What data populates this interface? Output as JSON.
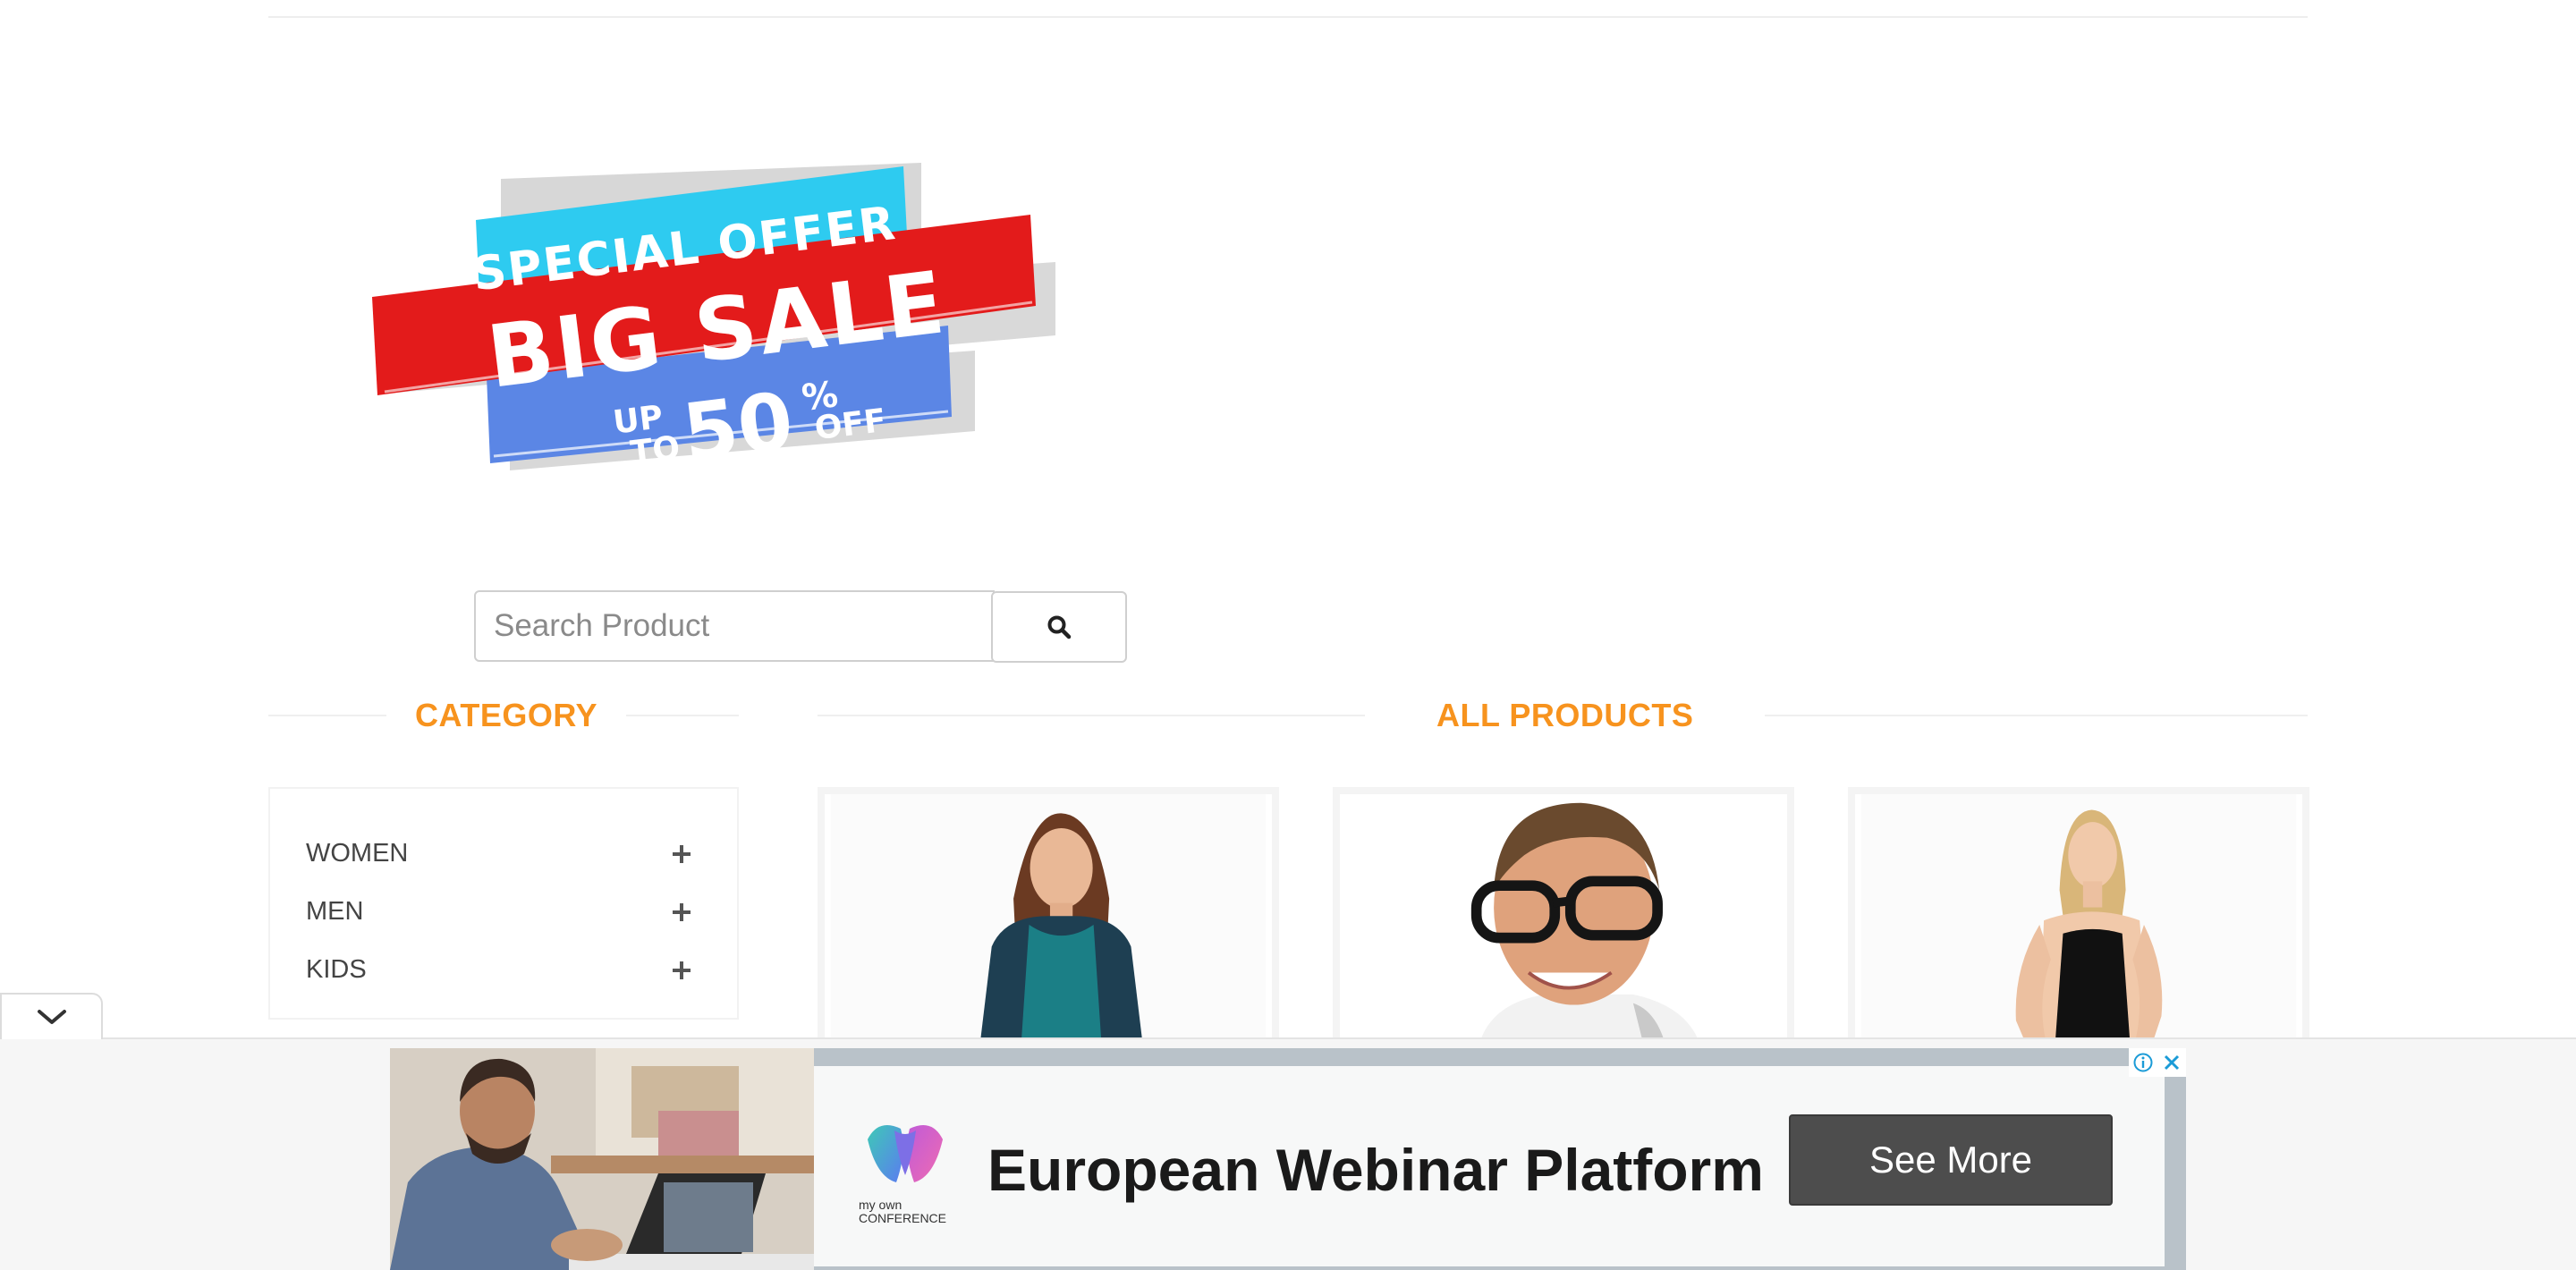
{
  "banner": {
    "line1": "SPECIAL OFFER",
    "line2": "BIG SALE",
    "up": "UP",
    "to": "TO",
    "amount": "50",
    "percent": "%",
    "off": "OFF"
  },
  "search": {
    "placeholder": "Search Product",
    "icon": "search-icon"
  },
  "category": {
    "title": "CATEGORY",
    "items": [
      {
        "label": "WOMEN",
        "icon": "plus-icon"
      },
      {
        "label": "MEN",
        "icon": "plus-icon"
      },
      {
        "label": "KIDS",
        "icon": "plus-icon"
      }
    ]
  },
  "products": {
    "title": "ALL PRODUCTS"
  },
  "ad": {
    "logo_text_line1": "my own",
    "logo_text_line2": "CONFERENCE",
    "headline": "European Webinar Platform",
    "cta": "See More",
    "info_icon": "info-icon",
    "close_icon": "close-icon"
  },
  "colors": {
    "accent": "#f7931e",
    "sale_red": "#e31b1b",
    "offer_cyan": "#2ecbf0",
    "discount_blue": "#5b86e5",
    "ad_button": "#4d4d4d"
  }
}
